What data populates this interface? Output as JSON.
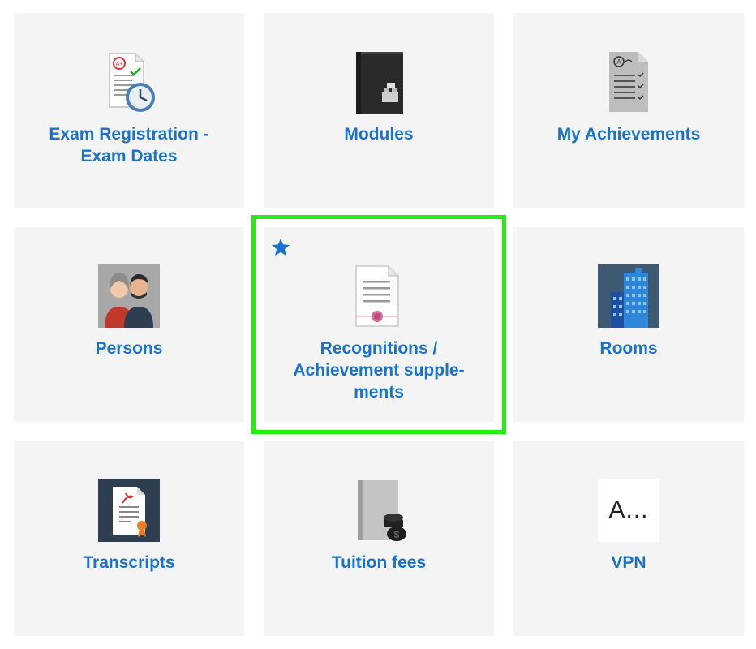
{
  "tiles": [
    {
      "label": "Exam Registration -\nExam Dates",
      "icon": "exam-registration-icon"
    },
    {
      "label": "Modules",
      "icon": "modules-book-icon"
    },
    {
      "label": "My Achievements",
      "icon": "achievements-document-icon"
    },
    {
      "label": "Persons",
      "icon": "persons-icon"
    },
    {
      "label": "Recognitions /\nAchievement supple-\nments",
      "icon": "certificate-icon",
      "favorite": true,
      "selected": true
    },
    {
      "label": "Rooms",
      "icon": "building-icon"
    },
    {
      "label": "Transcripts",
      "icon": "transcript-icon"
    },
    {
      "label": "Tuition fees",
      "icon": "tuition-fees-icon"
    },
    {
      "label": "VPN",
      "icon": "vpn-icon",
      "icon_text": "A..."
    }
  ],
  "colors": {
    "label": "#1a73c8",
    "tile_bg": "#f4f4f4",
    "selection": "#22ee11",
    "star": "#1a73c8"
  }
}
